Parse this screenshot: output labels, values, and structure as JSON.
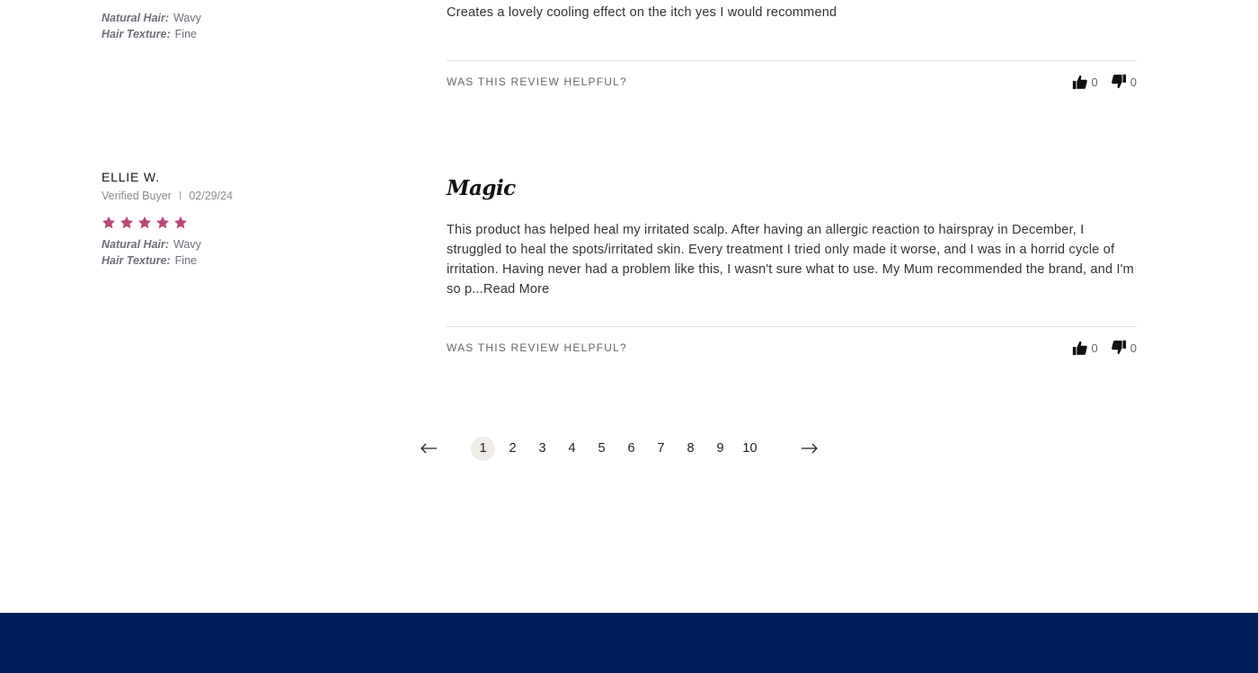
{
  "colors": {
    "star": "#b9477a",
    "footer": "#00205b",
    "active_page_bg": "#efece7"
  },
  "review_1": {
    "natural_hair_label": "Natural Hair:",
    "natural_hair_value": "Wavy",
    "hair_texture_label": "Hair Texture:",
    "hair_texture_value": "Fine",
    "text": "Creates a lovely cooling effect on the itch yes I would recommend",
    "helpful_label": "WAS THIS REVIEW HELPFUL?",
    "thumbs_up_icon": "thumbs-up-icon",
    "thumbs_down_icon": "thumbs-down-icon",
    "upvotes": "0",
    "downvotes": "0"
  },
  "review_2": {
    "name": "ELLIE W.",
    "verified": "Verified Buyer",
    "separator": "I",
    "date": "02/29/24",
    "rating": 5,
    "natural_hair_label": "Natural Hair:",
    "natural_hair_value": "Wavy",
    "hair_texture_label": "Hair Texture:",
    "hair_texture_value": "Fine",
    "title": "Magic",
    "text": "This product has helped heal my irritated scalp. After having an allergic reaction to hairspray in December, I struggled to heal the spots/irritated skin. Every treatment I tried only made it worse, and I was in a horrid cycle of irritation. Having never had a problem like this, I wasn't sure what to use. My Mum recommended the brand, and I'm so p...",
    "read_more": "Read More",
    "helpful_label": "WAS THIS REVIEW HELPFUL?",
    "upvotes": "0",
    "downvotes": "0"
  },
  "pagination": {
    "prev_icon": "arrow-left-icon",
    "next_icon": "arrow-right-icon",
    "pages": [
      "1",
      "2",
      "3",
      "4",
      "5",
      "6",
      "7",
      "8",
      "9",
      "10"
    ],
    "current": "1"
  }
}
